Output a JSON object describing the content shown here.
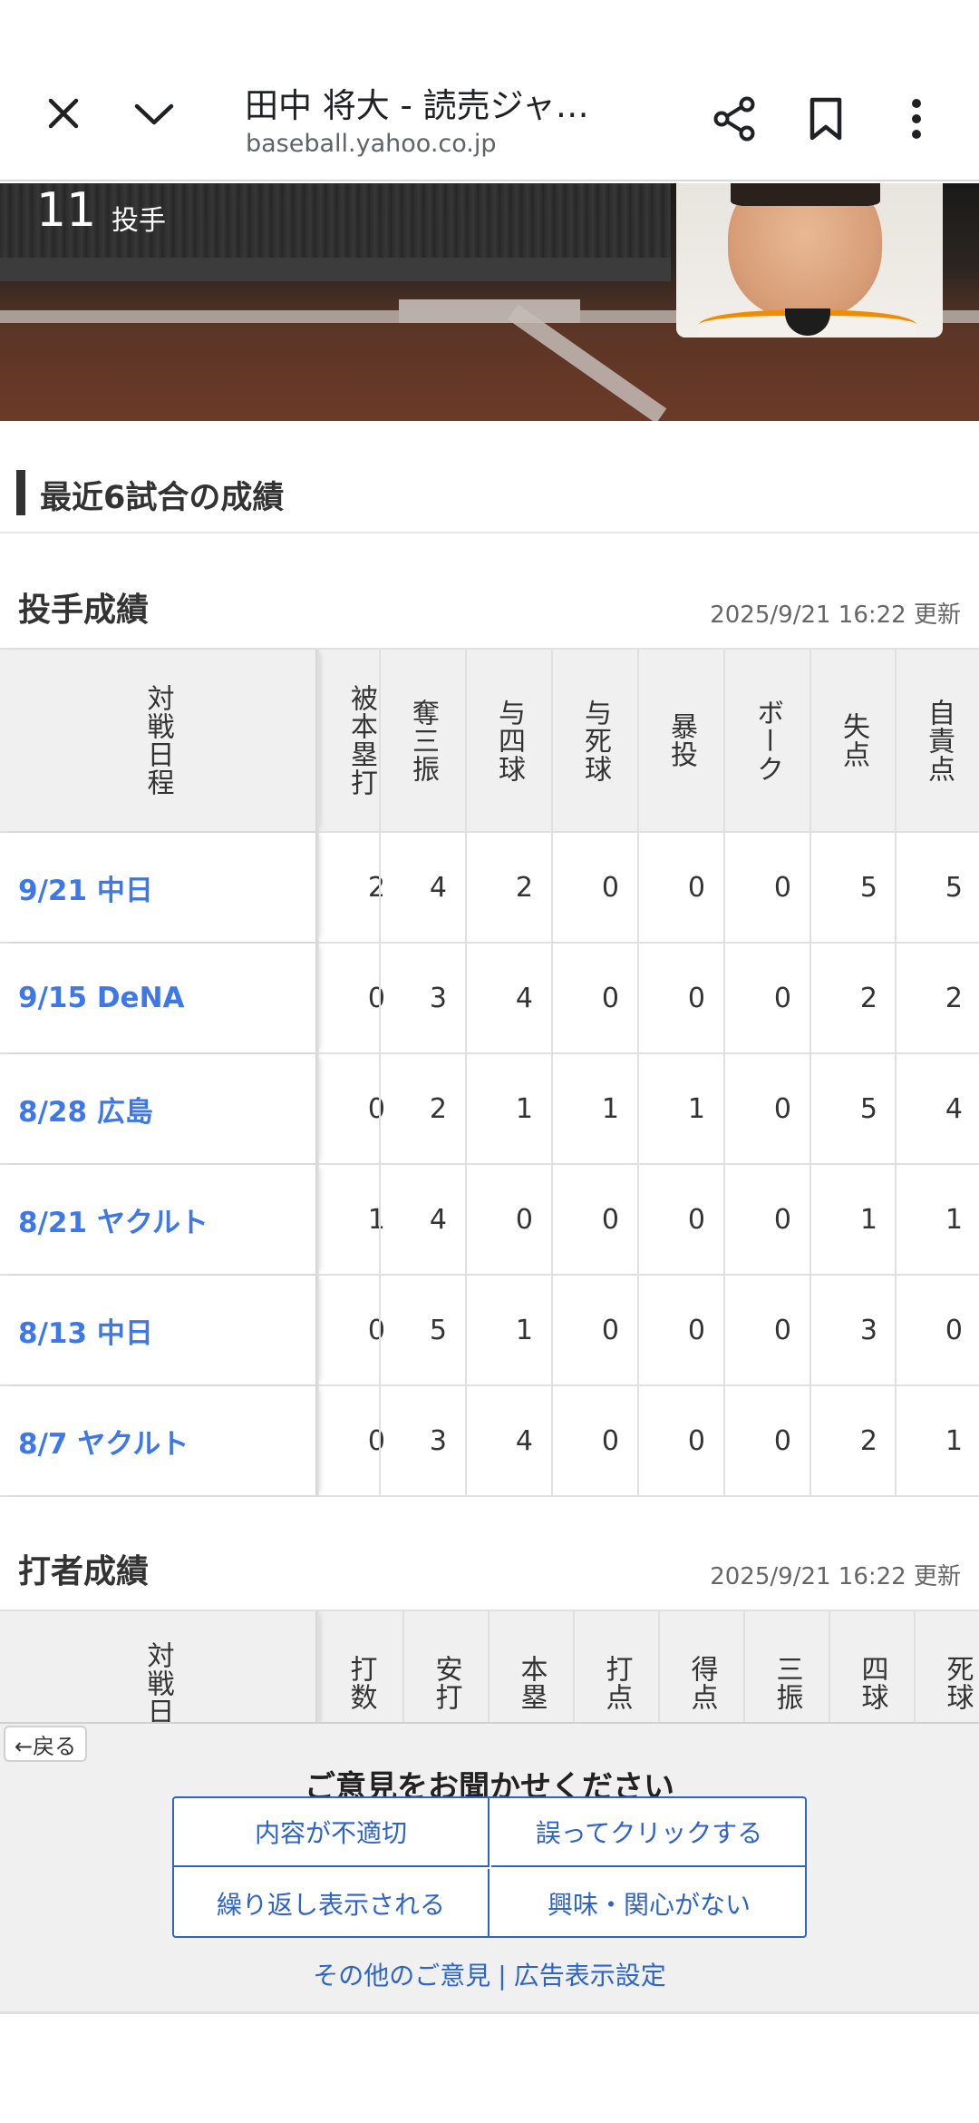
{
  "browser": {
    "title": "田中 将大 - 読売ジャ…",
    "url": "baseball.yahoo.co.jp"
  },
  "player": {
    "number": "11",
    "position": "投手"
  },
  "section": {
    "title": "最近6試合の成績"
  },
  "pitching": {
    "title": "投手成績",
    "updated": "2025/9/21 16:22 更新",
    "first_header": "対戦日程",
    "headers": [
      "被本塁打",
      "奪三振",
      "与四球",
      "与死球",
      "暴投",
      "ボーク",
      "失点",
      "自責点"
    ],
    "rows": [
      {
        "game": "9/21 中日",
        "values": [
          "2",
          "4",
          "2",
          "0",
          "0",
          "0",
          "5",
          "5"
        ]
      },
      {
        "game": "9/15 DeNA",
        "values": [
          "0",
          "3",
          "4",
          "0",
          "0",
          "0",
          "2",
          "2"
        ]
      },
      {
        "game": "8/28 広島",
        "values": [
          "0",
          "2",
          "1",
          "1",
          "1",
          "0",
          "5",
          "4"
        ]
      },
      {
        "game": "8/21 ヤクルト",
        "values": [
          "1",
          "4",
          "0",
          "0",
          "0",
          "0",
          "1",
          "1"
        ]
      },
      {
        "game": "8/13 中日",
        "values": [
          "0",
          "5",
          "1",
          "0",
          "0",
          "0",
          "3",
          "0"
        ]
      },
      {
        "game": "8/7 ヤクルト",
        "values": [
          "0",
          "3",
          "4",
          "0",
          "0",
          "0",
          "2",
          "1"
        ]
      }
    ]
  },
  "batting": {
    "title": "打者成績",
    "updated": "2025/9/21 16:22 更新",
    "first_header": "対戦日",
    "headers": [
      "打数",
      "安打",
      "本塁",
      "打点",
      "得点",
      "三振",
      "四球",
      "死球"
    ]
  },
  "ad_feedback": {
    "back_label": "←戻る",
    "title": "ご意見をお聞かせください",
    "options": [
      "内容が不適切",
      "誤ってクリックする",
      "繰り返し表示される",
      "興味・関心がない"
    ],
    "link_other": "その他のご意見",
    "link_separator": "|",
    "link_settings": "広告表示設定"
  }
}
